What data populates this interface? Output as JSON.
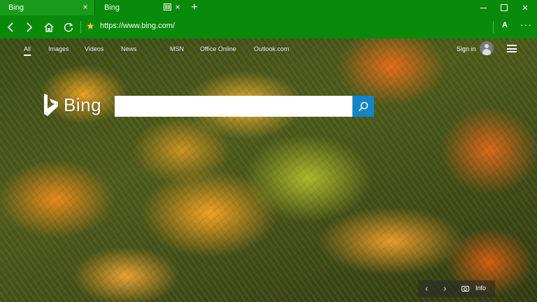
{
  "tabs": [
    {
      "title": "Bing",
      "close": "×"
    },
    {
      "title": "Bing",
      "close": "×"
    }
  ],
  "new_tab": "+",
  "window_controls": {
    "close": "✕"
  },
  "address_bar": {
    "url": "https://www.bing.com/",
    "favorite": "★",
    "reading": "A",
    "more": "···"
  },
  "icons": [
    "back-arrow-icon",
    "forward-arrow-icon",
    "home-icon",
    "refresh-icon",
    "star-icon",
    "reading-view-icon",
    "more-icon",
    "search-icon",
    "camera-icon",
    "hamburger-menu-icon",
    "avatar-icon",
    "media-playing-icon"
  ],
  "nav": {
    "links": [
      "All",
      "Images",
      "Videos",
      "News",
      "MSN",
      "Office Online",
      "Outlook.com"
    ],
    "signin": "Sign in"
  },
  "brand": {
    "logo_text": "Bing"
  },
  "search": {
    "value": "",
    "placeholder": ""
  },
  "image_bar": {
    "prev": "‹",
    "next": "›",
    "info": "Info"
  },
  "colors": {
    "chrome_green": "#0a8a0a",
    "search_button": "#1484c8",
    "star": "#f8d02a"
  }
}
